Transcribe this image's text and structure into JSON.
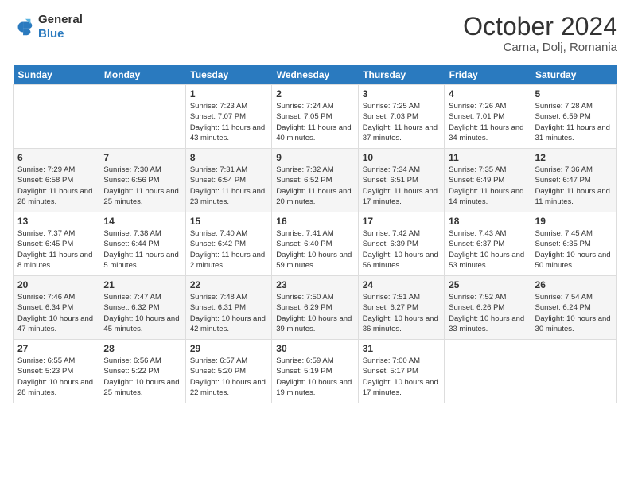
{
  "logo": {
    "general": "General",
    "blue": "Blue"
  },
  "title": "October 2024",
  "subtitle": "Carna, Dolj, Romania",
  "days_of_week": [
    "Sunday",
    "Monday",
    "Tuesday",
    "Wednesday",
    "Thursday",
    "Friday",
    "Saturday"
  ],
  "weeks": [
    [
      {
        "num": "",
        "sunrise": "",
        "sunset": "",
        "daylight": ""
      },
      {
        "num": "",
        "sunrise": "",
        "sunset": "",
        "daylight": ""
      },
      {
        "num": "1",
        "sunrise": "Sunrise: 7:23 AM",
        "sunset": "Sunset: 7:07 PM",
        "daylight": "Daylight: 11 hours and 43 minutes."
      },
      {
        "num": "2",
        "sunrise": "Sunrise: 7:24 AM",
        "sunset": "Sunset: 7:05 PM",
        "daylight": "Daylight: 11 hours and 40 minutes."
      },
      {
        "num": "3",
        "sunrise": "Sunrise: 7:25 AM",
        "sunset": "Sunset: 7:03 PM",
        "daylight": "Daylight: 11 hours and 37 minutes."
      },
      {
        "num": "4",
        "sunrise": "Sunrise: 7:26 AM",
        "sunset": "Sunset: 7:01 PM",
        "daylight": "Daylight: 11 hours and 34 minutes."
      },
      {
        "num": "5",
        "sunrise": "Sunrise: 7:28 AM",
        "sunset": "Sunset: 6:59 PM",
        "daylight": "Daylight: 11 hours and 31 minutes."
      }
    ],
    [
      {
        "num": "6",
        "sunrise": "Sunrise: 7:29 AM",
        "sunset": "Sunset: 6:58 PM",
        "daylight": "Daylight: 11 hours and 28 minutes."
      },
      {
        "num": "7",
        "sunrise": "Sunrise: 7:30 AM",
        "sunset": "Sunset: 6:56 PM",
        "daylight": "Daylight: 11 hours and 25 minutes."
      },
      {
        "num": "8",
        "sunrise": "Sunrise: 7:31 AM",
        "sunset": "Sunset: 6:54 PM",
        "daylight": "Daylight: 11 hours and 23 minutes."
      },
      {
        "num": "9",
        "sunrise": "Sunrise: 7:32 AM",
        "sunset": "Sunset: 6:52 PM",
        "daylight": "Daylight: 11 hours and 20 minutes."
      },
      {
        "num": "10",
        "sunrise": "Sunrise: 7:34 AM",
        "sunset": "Sunset: 6:51 PM",
        "daylight": "Daylight: 11 hours and 17 minutes."
      },
      {
        "num": "11",
        "sunrise": "Sunrise: 7:35 AM",
        "sunset": "Sunset: 6:49 PM",
        "daylight": "Daylight: 11 hours and 14 minutes."
      },
      {
        "num": "12",
        "sunrise": "Sunrise: 7:36 AM",
        "sunset": "Sunset: 6:47 PM",
        "daylight": "Daylight: 11 hours and 11 minutes."
      }
    ],
    [
      {
        "num": "13",
        "sunrise": "Sunrise: 7:37 AM",
        "sunset": "Sunset: 6:45 PM",
        "daylight": "Daylight: 11 hours and 8 minutes."
      },
      {
        "num": "14",
        "sunrise": "Sunrise: 7:38 AM",
        "sunset": "Sunset: 6:44 PM",
        "daylight": "Daylight: 11 hours and 5 minutes."
      },
      {
        "num": "15",
        "sunrise": "Sunrise: 7:40 AM",
        "sunset": "Sunset: 6:42 PM",
        "daylight": "Daylight: 11 hours and 2 minutes."
      },
      {
        "num": "16",
        "sunrise": "Sunrise: 7:41 AM",
        "sunset": "Sunset: 6:40 PM",
        "daylight": "Daylight: 10 hours and 59 minutes."
      },
      {
        "num": "17",
        "sunrise": "Sunrise: 7:42 AM",
        "sunset": "Sunset: 6:39 PM",
        "daylight": "Daylight: 10 hours and 56 minutes."
      },
      {
        "num": "18",
        "sunrise": "Sunrise: 7:43 AM",
        "sunset": "Sunset: 6:37 PM",
        "daylight": "Daylight: 10 hours and 53 minutes."
      },
      {
        "num": "19",
        "sunrise": "Sunrise: 7:45 AM",
        "sunset": "Sunset: 6:35 PM",
        "daylight": "Daylight: 10 hours and 50 minutes."
      }
    ],
    [
      {
        "num": "20",
        "sunrise": "Sunrise: 7:46 AM",
        "sunset": "Sunset: 6:34 PM",
        "daylight": "Daylight: 10 hours and 47 minutes."
      },
      {
        "num": "21",
        "sunrise": "Sunrise: 7:47 AM",
        "sunset": "Sunset: 6:32 PM",
        "daylight": "Daylight: 10 hours and 45 minutes."
      },
      {
        "num": "22",
        "sunrise": "Sunrise: 7:48 AM",
        "sunset": "Sunset: 6:31 PM",
        "daylight": "Daylight: 10 hours and 42 minutes."
      },
      {
        "num": "23",
        "sunrise": "Sunrise: 7:50 AM",
        "sunset": "Sunset: 6:29 PM",
        "daylight": "Daylight: 10 hours and 39 minutes."
      },
      {
        "num": "24",
        "sunrise": "Sunrise: 7:51 AM",
        "sunset": "Sunset: 6:27 PM",
        "daylight": "Daylight: 10 hours and 36 minutes."
      },
      {
        "num": "25",
        "sunrise": "Sunrise: 7:52 AM",
        "sunset": "Sunset: 6:26 PM",
        "daylight": "Daylight: 10 hours and 33 minutes."
      },
      {
        "num": "26",
        "sunrise": "Sunrise: 7:54 AM",
        "sunset": "Sunset: 6:24 PM",
        "daylight": "Daylight: 10 hours and 30 minutes."
      }
    ],
    [
      {
        "num": "27",
        "sunrise": "Sunrise: 6:55 AM",
        "sunset": "Sunset: 5:23 PM",
        "daylight": "Daylight: 10 hours and 28 minutes."
      },
      {
        "num": "28",
        "sunrise": "Sunrise: 6:56 AM",
        "sunset": "Sunset: 5:22 PM",
        "daylight": "Daylight: 10 hours and 25 minutes."
      },
      {
        "num": "29",
        "sunrise": "Sunrise: 6:57 AM",
        "sunset": "Sunset: 5:20 PM",
        "daylight": "Daylight: 10 hours and 22 minutes."
      },
      {
        "num": "30",
        "sunrise": "Sunrise: 6:59 AM",
        "sunset": "Sunset: 5:19 PM",
        "daylight": "Daylight: 10 hours and 19 minutes."
      },
      {
        "num": "31",
        "sunrise": "Sunrise: 7:00 AM",
        "sunset": "Sunset: 5:17 PM",
        "daylight": "Daylight: 10 hours and 17 minutes."
      },
      {
        "num": "",
        "sunrise": "",
        "sunset": "",
        "daylight": ""
      },
      {
        "num": "",
        "sunrise": "",
        "sunset": "",
        "daylight": ""
      }
    ]
  ]
}
